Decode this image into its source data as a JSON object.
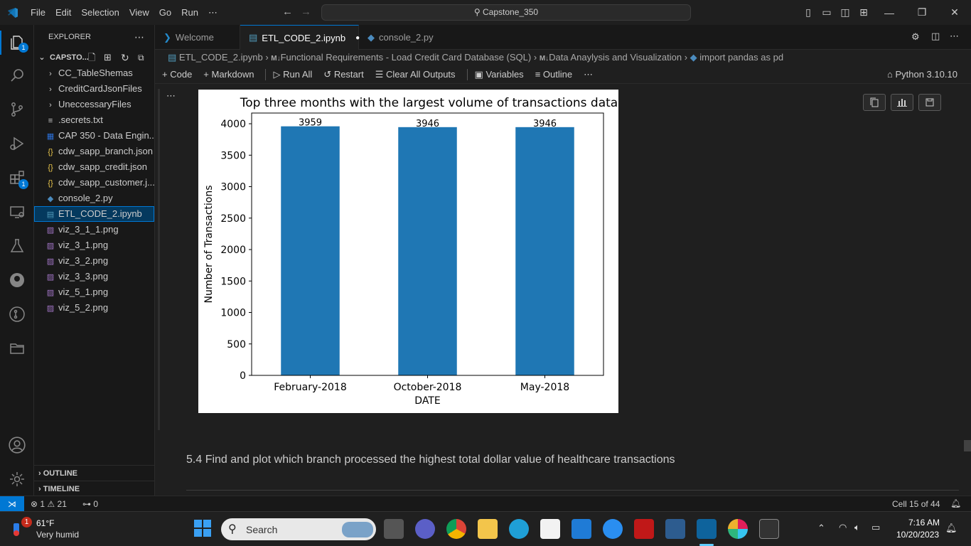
{
  "titlebar": {
    "menu": [
      "File",
      "Edit",
      "Selection",
      "View",
      "Go",
      "Run",
      "⋯"
    ],
    "search_text": "Capstone_350"
  },
  "activitybar": {
    "explorer_badge": "1",
    "extensions_badge": "1",
    "account_badge": ""
  },
  "sidebar": {
    "header": "EXPLORER",
    "root": "CAPSTO...",
    "items": [
      {
        "label": "CC_TableShemas",
        "icon": "chevron-right-icon",
        "kind": "folder"
      },
      {
        "label": "CreditCardJsonFiles",
        "icon": "chevron-right-icon",
        "kind": "folder"
      },
      {
        "label": "UneccessaryFiles",
        "icon": "chevron-right-icon",
        "kind": "folder"
      },
      {
        "label": ".secrets.txt",
        "icon": "text-file-icon",
        "kind": "txt"
      },
      {
        "label": "CAP 350 - Data Engin...",
        "icon": "word-doc-icon",
        "kind": "doc"
      },
      {
        "label": "cdw_sapp_branch.json",
        "icon": "json-icon",
        "kind": "json"
      },
      {
        "label": "cdw_sapp_credit.json",
        "icon": "json-icon",
        "kind": "json"
      },
      {
        "label": "cdw_sapp_customer.j...",
        "icon": "json-icon",
        "kind": "json"
      },
      {
        "label": "console_2.py",
        "icon": "python-icon",
        "kind": "py"
      },
      {
        "label": "ETL_CODE_2.ipynb",
        "icon": "notebook-icon",
        "kind": "ipynb",
        "selected": true
      },
      {
        "label": "viz_3_1_1.png",
        "icon": "image-icon",
        "kind": "png"
      },
      {
        "label": "viz_3_1.png",
        "icon": "image-icon",
        "kind": "png"
      },
      {
        "label": "viz_3_2.png",
        "icon": "image-icon",
        "kind": "png"
      },
      {
        "label": "viz_3_3.png",
        "icon": "image-icon",
        "kind": "png"
      },
      {
        "label": "viz_5_1.png",
        "icon": "image-icon",
        "kind": "png"
      },
      {
        "label": "viz_5_2.png",
        "icon": "image-icon",
        "kind": "png"
      }
    ],
    "outline": "OUTLINE",
    "timeline": "TIMELINE"
  },
  "tabs": [
    {
      "label": "Welcome",
      "active": false
    },
    {
      "label": "ETL_CODE_2.ipynb",
      "active": true
    },
    {
      "label": "console_2.py",
      "active": false
    }
  ],
  "breadcrumb": {
    "file": "ETL_CODE_2.ipynb",
    "sec1": "Functional Requirements - Load Credit Card Database (SQL)",
    "sec2": "Data Anaylysis and Visualization",
    "cell": "import pandas as pd"
  },
  "nbtoolbar": {
    "code": "Code",
    "markdown": "Markdown",
    "run_all": "Run All",
    "restart": "Restart",
    "clear": "Clear All Outputs",
    "variables": "Variables",
    "outline": "Outline",
    "more": "⋯",
    "kernel": "Python 3.10.10"
  },
  "chart_data": {
    "type": "bar",
    "title": "Top three months with the largest volume of transactions data",
    "xlabel": "DATE",
    "ylabel": "Number of Transactions",
    "categories": [
      "February-2018",
      "October-2018",
      "May-2018"
    ],
    "values": [
      3959,
      3946,
      3946
    ],
    "data_labels": [
      "3959",
      "3946",
      "3946"
    ],
    "ylim": [
      0,
      4170
    ],
    "yticks": [
      0,
      500,
      1000,
      1500,
      2000,
      2500,
      3000,
      3500,
      4000
    ],
    "bar_color": "#1f77b4",
    "grid": false
  },
  "markdown_cell": "5.4 Find and plot which branch processed the highest total dollar value of healthcare transactions",
  "statusbar": {
    "errors": "1",
    "warnings": "21",
    "ports": "0",
    "cell_pos": "Cell 15 of 44"
  },
  "taskbar": {
    "weather_temp": "61°F",
    "weather_desc": "Very humid",
    "weather_badge": "1",
    "search": "Search",
    "time": "7:16 AM",
    "date": "10/20/2023"
  }
}
